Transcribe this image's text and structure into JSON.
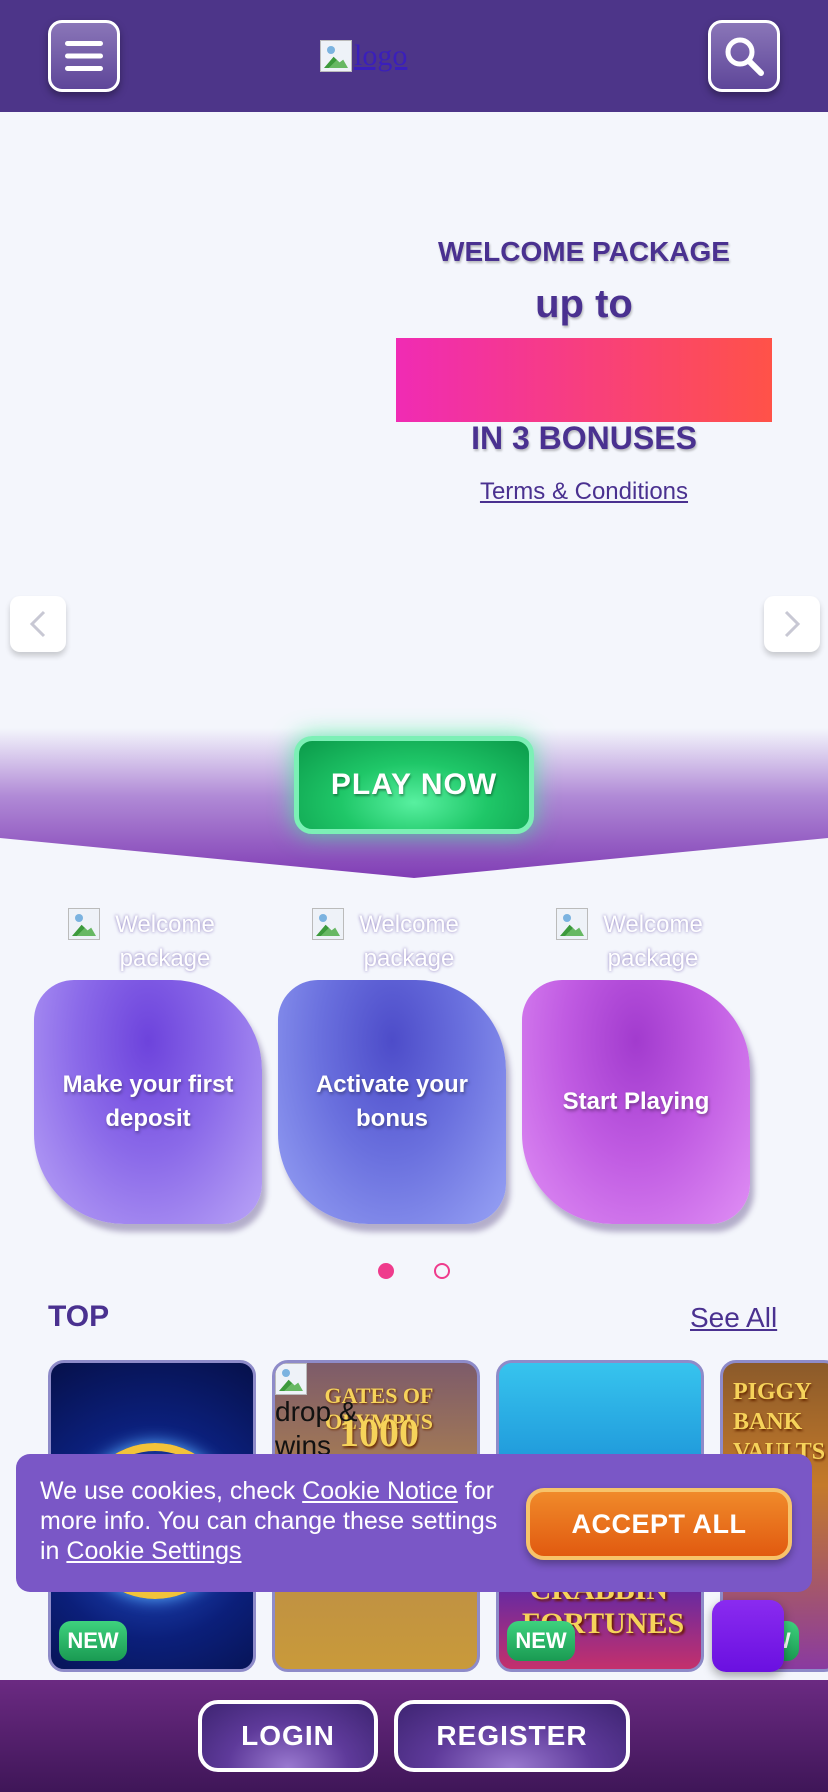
{
  "header": {
    "logo_alt": "logo"
  },
  "hero": {
    "pre_title": "WELCOME PACKAGE",
    "up_to": "up to",
    "post_title": "IN 3 BONUSES",
    "terms_link": "Terms & Conditions"
  },
  "play_now": "PLAY NOW",
  "steps": [
    {
      "img_alt": "Welcome package",
      "label": "Make your first deposit"
    },
    {
      "img_alt": "Welcome package",
      "label": "Activate your bonus"
    },
    {
      "img_alt": "Welcome package",
      "label": "Start Playing"
    }
  ],
  "pager": {
    "count": 2,
    "active_index": 0
  },
  "top_section": {
    "title": "TOP",
    "see_all": "See All",
    "games": [
      {
        "badge": "NEW"
      },
      {
        "title_line1": "GATES OF OLYMPUS",
        "title_line2": "1000",
        "img_alt": "drop & wins"
      },
      {
        "title": "CRABBIN' FORTUNES",
        "badge": "NEW"
      },
      {
        "title": "PIGGY BANK VAULTS",
        "badge": "NEW"
      }
    ]
  },
  "cookie_banner": {
    "text_1": "We use cookies, check ",
    "link_1": "Cookie Notice",
    "text_2": " for more info. You can change these settings in ",
    "link_2": "Cookie Settings",
    "accept": "ACCEPT ALL"
  },
  "bottom_bar": {
    "login": "LOGIN",
    "register": "REGISTER"
  },
  "colors": {
    "header_bg": "#4d3589",
    "accent_pink": "#ef3b8c",
    "play_green": "#1fc768",
    "accept_orange": "#e15a10",
    "text_purple": "#4a3190"
  }
}
